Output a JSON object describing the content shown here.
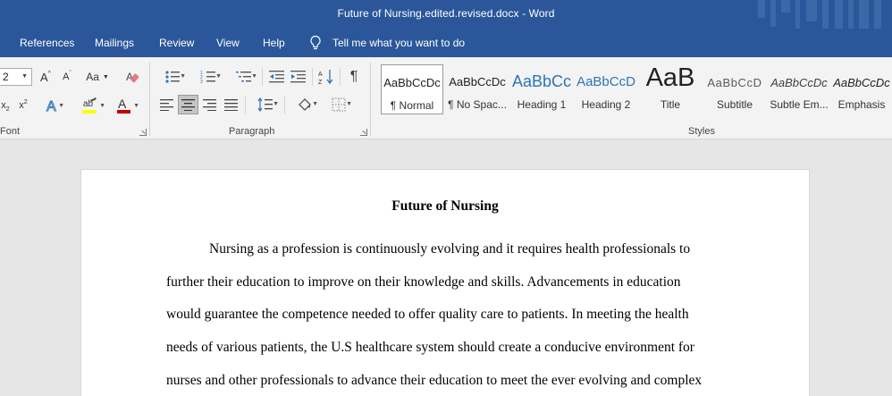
{
  "window": {
    "title": "Future of Nursing.edited.revised.docx  -  Word"
  },
  "ribbon_tabs": [
    "References",
    "Mailings",
    "Review",
    "View",
    "Help"
  ],
  "tell_me": "Tell me what you want to do",
  "font_group": {
    "label": "Font",
    "font_size": "2"
  },
  "paragraph_group": {
    "label": "Paragraph"
  },
  "styles_group": {
    "label": "Styles",
    "items": [
      {
        "sample": "AaBbCcDc",
        "name": "¶ Normal"
      },
      {
        "sample": "AaBbCcDc",
        "name": "¶ No Spac..."
      },
      {
        "sample": "AaBbCc",
        "name": "Heading 1"
      },
      {
        "sample": "AaBbCcD",
        "name": "Heading 2"
      },
      {
        "sample": "AaB",
        "name": "Title"
      },
      {
        "sample": "AaBbCcD",
        "name": "Subtitle"
      },
      {
        "sample": "AaBbCcDc",
        "name": "Subtle Em..."
      },
      {
        "sample": "AaBbCcDc",
        "name": "Emphasis"
      }
    ]
  },
  "document": {
    "title": "Future of Nursing",
    "lines": [
      "Nursing as a profession is continuously evolving and it requires health professionals to",
      "further their education to improve on their knowledge and skills. Advancements in education",
      "would guarantee the competence needed to offer quality care to patients. In meeting the health",
      "needs of various patients, the U.S healthcare system should create a conducive environment for",
      "nurses and other professionals to advance their education to meet the ever evolving and complex"
    ]
  },
  "colors": {
    "titlebar": "#2b579a",
    "ribbon": "#f3f3f3",
    "canvas": "#e6e6e6",
    "highlight": "#ffff00",
    "font_color": "#c00000"
  }
}
